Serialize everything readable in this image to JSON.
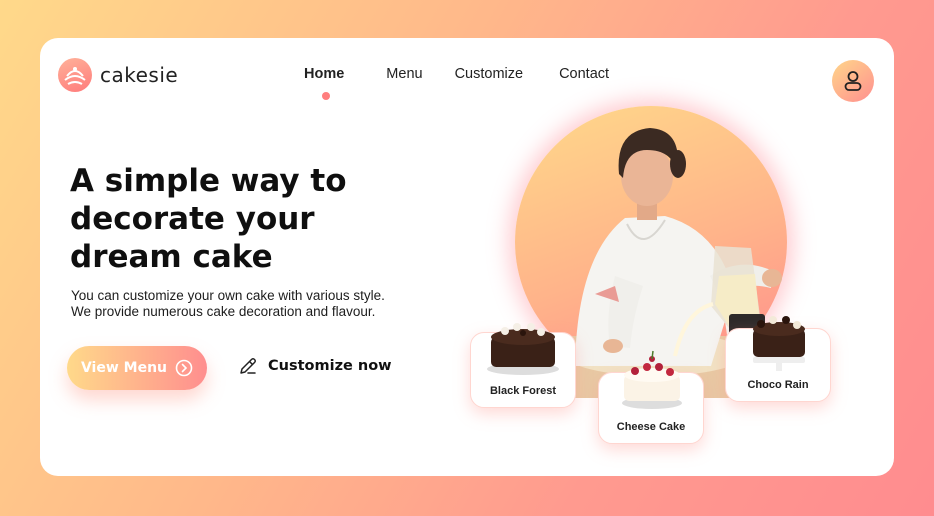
{
  "brand": {
    "name": "cakesie"
  },
  "nav": {
    "items": [
      {
        "label": "Home",
        "active": true
      },
      {
        "label": "Menu"
      },
      {
        "label": "Customize"
      },
      {
        "label": "Contact"
      }
    ]
  },
  "hero": {
    "headline_lines": [
      "A simple way to",
      "decorate your",
      "dream cake"
    ],
    "subtext_lines": [
      "You can customize your own cake with various style.",
      "We provide numerous cake decoration and flavour."
    ],
    "primary_button": "View Menu",
    "secondary_button": "Customize now"
  },
  "cakes": [
    {
      "label": "Black Forest"
    },
    {
      "label": "Cheese Cake"
    },
    {
      "label": "Choco Rain"
    }
  ],
  "colors": {
    "accent": "#ff7e7e",
    "gradient_start": "#ffd98a",
    "gradient_end": "#ff8e8e"
  },
  "icons": {
    "logo": "cake-logo-icon",
    "profile": "user-icon",
    "button": "chevron-circle-right-icon",
    "customize": "pencil-icon"
  }
}
